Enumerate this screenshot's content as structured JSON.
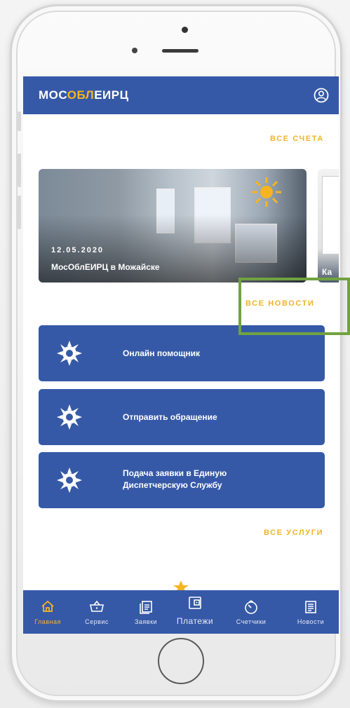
{
  "app": {
    "logo_part1": "МОС",
    "logo_part2": "ОБЛ",
    "logo_part3": "ЕИРЦ"
  },
  "links": {
    "all_accounts": "ВСЕ СЧЕТА",
    "all_news": "ВСЕ НОВОСТИ",
    "all_services": "ВСЕ УСЛУГИ"
  },
  "news": [
    {
      "date": "12.05.2020",
      "title": "МосОблЕИРЦ в Можайске"
    },
    {
      "date": "",
      "title": "Ка"
    }
  ],
  "services": [
    {
      "label_line1": "Онлайн помощник",
      "label_line2": ""
    },
    {
      "label_line1": "Отправить обращение",
      "label_line2": ""
    },
    {
      "label_line1": "Подача заявки в Единую",
      "label_line2": "Диспетчерскую Службу"
    }
  ],
  "nav": [
    {
      "label": "Главная",
      "icon": "home-icon",
      "active": true
    },
    {
      "label": "Сервис",
      "icon": "basket-icon",
      "active": false
    },
    {
      "label": "Заявки",
      "icon": "requests-icon",
      "active": false
    },
    {
      "label": "Платежи",
      "icon": "wallet-icon",
      "active": false
    },
    {
      "label": "Счетчики",
      "icon": "meter-icon",
      "active": false
    },
    {
      "label": "Новости",
      "icon": "news-icon",
      "active": false
    }
  ],
  "colors": {
    "primary": "#3659a7",
    "accent": "#f6b520",
    "highlight": "#70a240"
  }
}
